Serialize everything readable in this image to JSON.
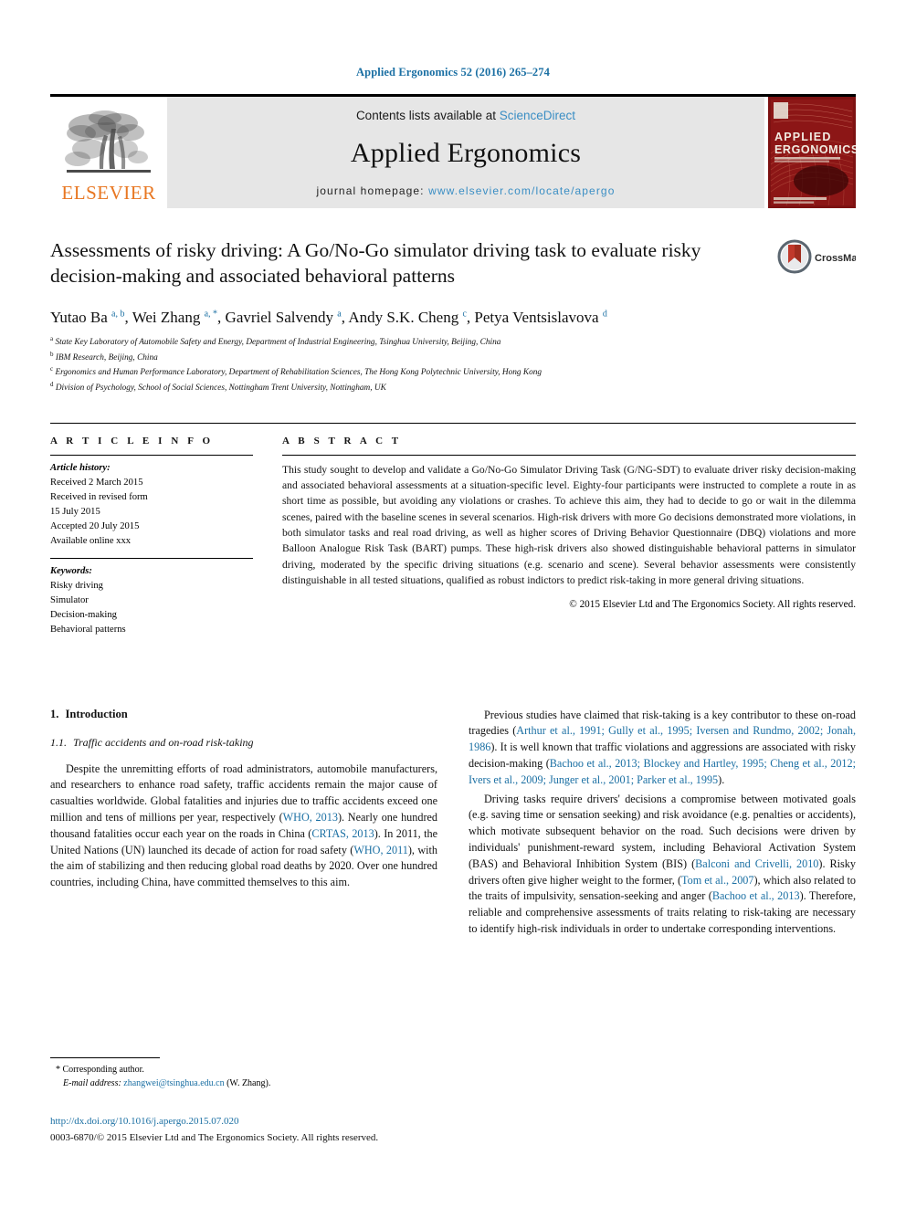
{
  "running_head": "Applied Ergonomics 52 (2016) 265–274",
  "masthead": {
    "contents_prefix": "Contents lists available at ",
    "sciencedirect": "ScienceDirect",
    "journal_name": "Applied Ergonomics",
    "homepage_label": "journal homepage: ",
    "homepage_url": "www.elsevier.com/locate/apergo",
    "publisher": "ELSEVIER",
    "cover_title_line1": "APPLIED",
    "cover_title_line2": "ERGONOMICS",
    "link_color": "#3a8ec4",
    "publisher_color": "#E87722",
    "cover_color": "#8c1616"
  },
  "article": {
    "title": "Assessments of risky driving: A Go/No-Go simulator driving task to evaluate risky decision-making and associated behavioral patterns",
    "crossmark_label": "CrossMark",
    "authors": [
      {
        "name": "Yutao Ba",
        "sup": "a, b",
        "sep": ", "
      },
      {
        "name": "Wei Zhang",
        "sup": "a, *",
        "sep": ", "
      },
      {
        "name": "Gavriel Salvendy",
        "sup": "a",
        "sep": ", "
      },
      {
        "name": "Andy S.K. Cheng",
        "sup": "c",
        "sep": ", "
      },
      {
        "name": "Petya Ventsislavova",
        "sup": "d",
        "sep": ""
      }
    ],
    "affiliations": [
      {
        "mark": "a",
        "text": "State Key Laboratory of Automobile Safety and Energy, Department of Industrial Engineering, Tsinghua University, Beijing, China"
      },
      {
        "mark": "b",
        "text": "IBM Research, Beijing, China"
      },
      {
        "mark": "c",
        "text": "Ergonomics and Human Performance Laboratory, Department of Rehabilitation Sciences, The Hong Kong Polytechnic University, Hong Kong"
      },
      {
        "mark": "d",
        "text": "Division of Psychology, School of Social Sciences, Nottingham Trent University, Nottingham, UK"
      }
    ]
  },
  "article_info": {
    "heading": "A R T I C L E  I N F O",
    "history_label": "Article history:",
    "history": [
      "Received 2 March 2015",
      "Received in revised form",
      "15 July 2015",
      "Accepted 20 July 2015",
      "Available online xxx"
    ],
    "keywords_label": "Keywords:",
    "keywords": [
      "Risky driving",
      "Simulator",
      "Decision-making",
      "Behavioral patterns"
    ]
  },
  "abstract": {
    "heading": "A B S T R A C T",
    "text": "This study sought to develop and validate a Go/No-Go Simulator Driving Task (G/NG-SDT) to evaluate driver risky decision-making and associated behavioral assessments at a situation-specific level. Eighty-four participants were instructed to complete a route in as short time as possible, but avoiding any violations or crashes. To achieve this aim, they had to decide to go or wait in the dilemma scenes, paired with the baseline scenes in several scenarios. High-risk drivers with more Go decisions demonstrated more violations, in both simulator tasks and real road driving, as well as higher scores of Driving Behavior Questionnaire (DBQ) violations and more Balloon Analogue Risk Task (BART) pumps. These high-risk drivers also showed distinguishable behavioral patterns in simulator driving, moderated by the specific driving situations (e.g. scenario and scene). Several behavior assessments were consistently distinguishable in all tested situations, qualified as robust indictors to predict risk-taking in more general driving situations.",
    "copyright": "© 2015 Elsevier Ltd and The Ergonomics Society. All rights reserved."
  },
  "sections": {
    "intro_number": "1.",
    "intro_title": "Introduction",
    "sub_number": "1.1.",
    "sub_title": "Traffic accidents and on-road risk-taking"
  },
  "left_column": {
    "paragraph_1": {
      "part1": "Despite the unremitting efforts of road administrators, automobile manufacturers, and researchers to enhance road safety, traffic accidents remain the major cause of casualties worldwide. Global fatalities and injuries due to traffic accidents exceed one million and tens of millions per year, respectively (",
      "cite1": "WHO, 2013",
      "part2": "). Nearly one hundred thousand fatalities occur each year on the roads in China (",
      "cite2": "CRTAS, 2013",
      "part3": "). In 2011, the United Nations (UN) launched its decade of action for road safety (",
      "cite3": "WHO, 2011",
      "part4": "), with the aim of stabilizing and then reducing global road deaths by 2020. Over one hundred countries, including China, have committed themselves to this aim."
    }
  },
  "right_column": {
    "paragraph_1": {
      "part1": "Previous studies have claimed that risk-taking is a key contributor to these on-road tragedies (",
      "cite1": "Arthur et al., 1991; Gully et al., 1995; Iversen and Rundmo, 2002; Jonah, 1986",
      "part2": "). It is well known that traffic violations and aggressions are associated with risky decision-making (",
      "cite2": "Bachoo et al., 2013; Blockey and Hartley, 1995; Cheng et al., 2012; Ivers et al., 2009; Junger et al., 2001; Parker et al., 1995",
      "part3": ")."
    },
    "paragraph_2": {
      "part1": "Driving tasks require drivers' decisions a compromise between motivated goals (e.g. saving time or sensation seeking) and risk avoidance (e.g. penalties or accidents), which motivate subsequent behavior on the road. Such decisions were driven by individuals' punishment-reward system, including Behavioral Activation System (BAS) and Behavioral Inhibition System (BIS) (",
      "cite1": "Balconi and Crivelli, 2010",
      "part2": "). Risky drivers often give higher weight to the former, (",
      "cite2": "Tom et al., 2007",
      "part3": "), which also related to the traits of impulsivity, sensation-seeking and anger (",
      "cite3": "Bachoo et al., 2013",
      "part4": "). Therefore, reliable and comprehensive assessments of traits relating to risk-taking are necessary to identify high-risk individuals in order to undertake corresponding interventions."
    }
  },
  "footer": {
    "corresponding_marker": "*",
    "corresponding_label": "Corresponding author.",
    "email_label": "E-mail address:",
    "email": "zhangwei@tsinghua.edu.cn",
    "email_owner": "(W. Zhang).",
    "doi": "http://dx.doi.org/10.1016/j.apergo.2015.07.020",
    "issn_line": "0003-6870/© 2015 Elsevier Ltd and The Ergonomics Society. All rights reserved."
  }
}
